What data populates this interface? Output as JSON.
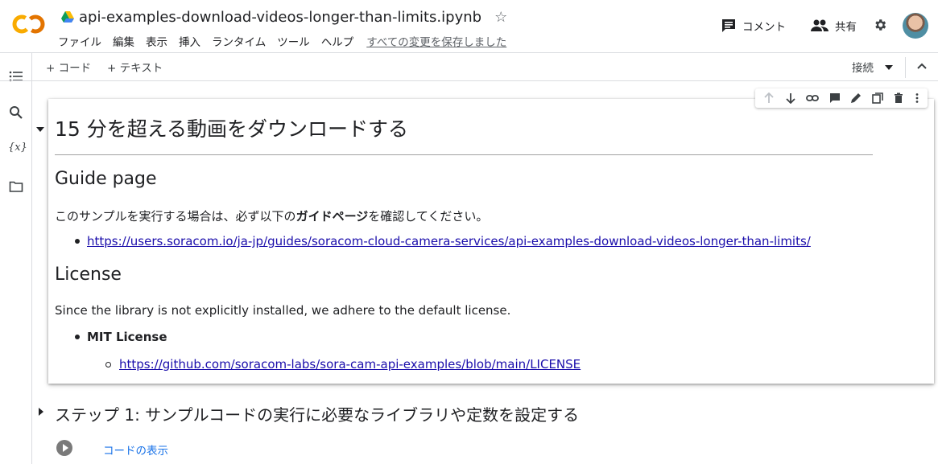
{
  "app": {
    "logo": "CO"
  },
  "header": {
    "title": "api-examples-download-videos-longer-than-limits.ipynb",
    "menu": [
      "ファイル",
      "編集",
      "表示",
      "挿入",
      "ランタイム",
      "ツール",
      "ヘルプ"
    ],
    "save_status": "すべての変更を保存しました",
    "comment_label": "コメント",
    "share_label": "共有"
  },
  "toolbar": {
    "add_code": "+ コード",
    "add_text": "+ テキスト",
    "connect": "接続"
  },
  "cell": {
    "heading": "15 分を超える動画をダウンロードする",
    "guide_heading": "Guide page",
    "guide_text_before": "このサンプルを実行する場合は、必ず以下の",
    "guide_text_bold": "ガイドページ",
    "guide_text_after": "を確認してください。",
    "guide_link": "https://users.soracom.io/ja-jp/guides/soracom-cloud-camera-services/api-examples-download-videos-longer-than-limits/",
    "license_heading": "License",
    "license_text": "Since the library is not explicitly installed, we adhere to the default license.",
    "license_item": "MIT License",
    "license_link": "https://github.com/soracom-labs/sora-cam-api-examples/blob/main/LICENSE"
  },
  "next_section": {
    "heading": "ステップ 1: サンプルコードの実行に必要なライブラリや定数を設定する",
    "show_code": "コードの表示"
  },
  "colors": {
    "logo_orange": "#f9ab00",
    "logo_dark": "#e37400",
    "link": "#1a0dab",
    "accent": "#1a73e8"
  },
  "icons": [
    "drive-icon",
    "star-icon",
    "comment-icon",
    "people-icon",
    "gear-icon",
    "toc-icon",
    "search-icon",
    "variables-icon",
    "folder-icon",
    "dropdown-arrow-icon",
    "collapse-icon",
    "arrow-up-icon",
    "arrow-down-icon",
    "link-icon",
    "comment-cell-icon",
    "edit-icon",
    "mirror-icon",
    "trash-icon",
    "more-icon",
    "play-icon"
  ]
}
